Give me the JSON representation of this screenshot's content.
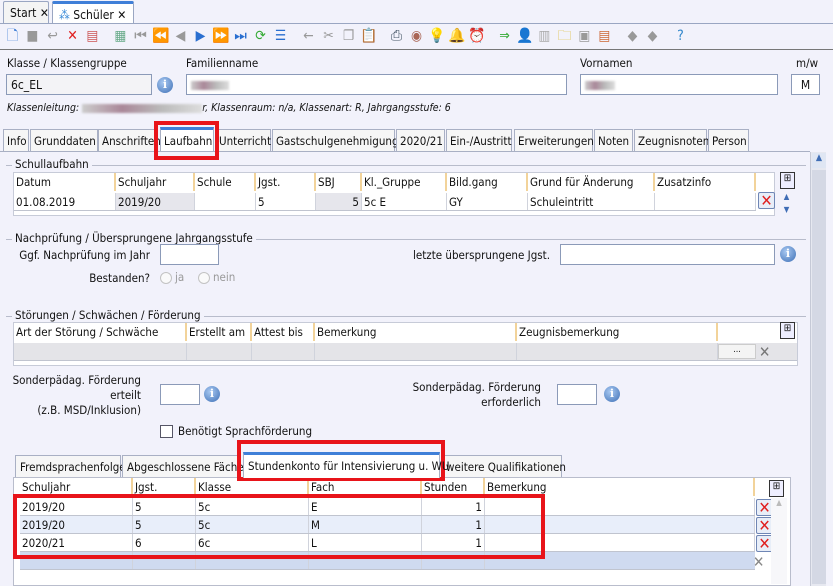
{
  "doc_tabs": [
    {
      "label": "Start"
    },
    {
      "label": "Schüler"
    }
  ],
  "toolbar": [
    "new-icon",
    "save-icon",
    "undo-icon",
    "delete-icon",
    "form-delete-icon",
    "copy-record-icon",
    "first-icon",
    "prev-page-icon",
    "prev-icon",
    "next-icon",
    "next-page-icon",
    "last-icon",
    "refresh-icon",
    "list-icon",
    "back-icon",
    "cut-icon",
    "copy-icon",
    "paste-icon",
    "print-icon",
    "view-icon",
    "idea-icon",
    "bell-icon",
    "alarm-icon",
    "export-icon",
    "user-icon",
    "tb-icon",
    "folder-icon",
    "edit-icon",
    "contact-icon",
    "shape-add-icon",
    "shape-remove-icon",
    "help-icon"
  ],
  "header": {
    "klasse_label": "Klasse / Klassengruppe",
    "klasse_value": "6c_EL",
    "familienname_label": "Familienname",
    "vornamen_label": "Vornamen",
    "mw_label": "m/w",
    "mw_value": "M",
    "info_line_prefix": "Klassenleitung:",
    "info_line_suffix": "r, Klassenraum: n/a, Klassenart: R, Jahrgangsstufe: 6"
  },
  "main_tabs": [
    "Info",
    "Grunddaten",
    "Anschriften",
    "Laufbahn",
    "Unterricht",
    "Gastschulgenehmigung",
    "2020/21",
    "Ein-/Austritt",
    "Erweiterungen",
    "Noten",
    "Zeugnisnoten",
    "Person"
  ],
  "active_tab": "Laufbahn",
  "schullaufbahn": {
    "title": "Schullaufbahn",
    "columns": [
      "Datum",
      "Schuljahr",
      "Schule",
      "Jgst.",
      "SBJ",
      "Kl._Gruppe",
      "Bild.gang",
      "Grund für Änderung",
      "Zusatzinfo"
    ],
    "rows": [
      [
        "01.08.2019",
        "2019/20",
        "",
        "5",
        "5",
        "5c E",
        "GY",
        "Schuleintritt",
        ""
      ]
    ]
  },
  "nachpruefung": {
    "title": "Nachprüfung / Übersprungene Jahrgangsstufe",
    "nachpruefung_label": "Ggf. Nachprüfung im Jahr",
    "bestanden_label": "Bestanden?",
    "ja": "ja",
    "nein": "nein",
    "uebersprungen_label": "letzte übersprungene Jgst."
  },
  "stoerungen": {
    "title": "Störungen / Schwächen / Förderung",
    "columns": [
      "Art der Störung / Schwäche",
      "Erstellt am",
      "Attest bis",
      "Bemerkung",
      "Zeugnisbemerkung"
    ],
    "ellipsis": "...",
    "foerderung_erteilt_label": [
      "Sonderpädag. Förderung",
      "erteilt",
      "(z.B. MSD/Inklusion)"
    ],
    "foerderung_erforderlich_label": [
      "Sonderpädag. Förderung",
      "erforderlich"
    ],
    "sprachfoerderung_label": "Benötigt Sprachförderung",
    "sprachfoerderung_checked": false
  },
  "sub_tabs": [
    "Fremdsprachenfolge",
    "Abgeschlossene Fächer",
    "Stundenkonto für Intensivierung u. WU",
    "weitere Qualifikationen"
  ],
  "active_sub_tab": "Stundenkonto für Intensivierung u. WU",
  "stundenkonto": {
    "columns": [
      "Schuljahr",
      "Jgst.",
      "Klasse",
      "Fach",
      "Stunden",
      "Bemerkung"
    ],
    "rows": [
      [
        "2019/20",
        "5",
        "5c",
        "E",
        "1",
        ""
      ],
      [
        "2019/20",
        "5",
        "5c",
        "M",
        "1",
        ""
      ],
      [
        "2020/21",
        "6",
        "6c",
        "L",
        "1",
        ""
      ]
    ]
  },
  "highlight_color": "#e8141a"
}
